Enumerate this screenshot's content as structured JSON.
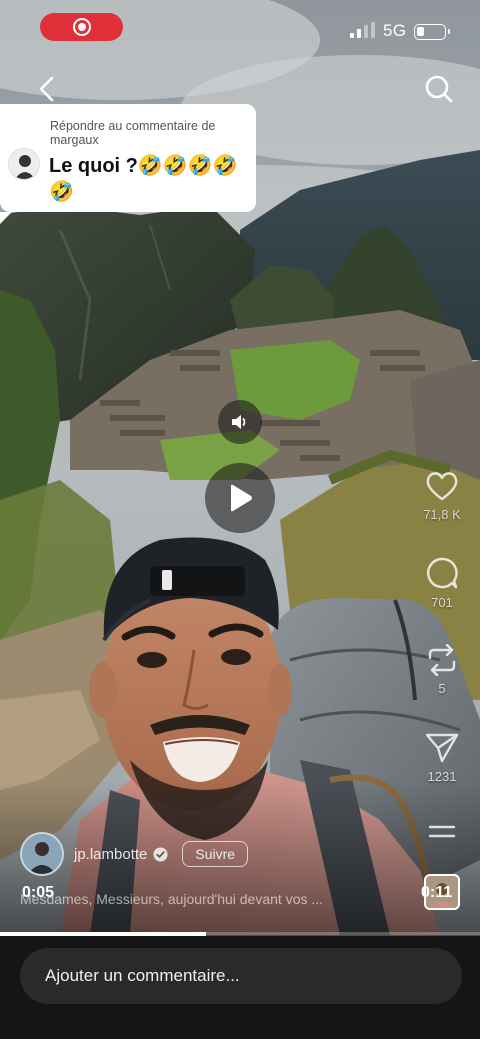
{
  "status_bar": {
    "network": "5G",
    "recording_indicator": "screen-record-icon",
    "battery_level": 0.25
  },
  "nav": {
    "back_icon": "chevron-left-icon",
    "search_icon": "search-icon"
  },
  "reply_card": {
    "heading": "Répondre au commentaire de margaux",
    "text": "Le quoi ?🤣🤣🤣🤣🤣"
  },
  "player": {
    "mute_icon": "speaker-icon",
    "play_icon": "play-icon",
    "current_time": "0:05",
    "total_time": "0:11",
    "progress": 0.43
  },
  "actions": {
    "like_count": "71,8 K",
    "comment_count": "701",
    "share_count": "5",
    "send_count": "1231"
  },
  "author": {
    "username": "jp.lambotte",
    "follow_label": "Suivre",
    "caption": "Mesdames, Messieurs, aujourd'hui devant vos ..."
  },
  "comment_bar": {
    "placeholder": "Ajouter un commentaire..."
  },
  "colors": {
    "record_pill": "#e0313a",
    "comment_bar_bg": "#151515",
    "comment_input_bg": "#2a2a2a"
  }
}
